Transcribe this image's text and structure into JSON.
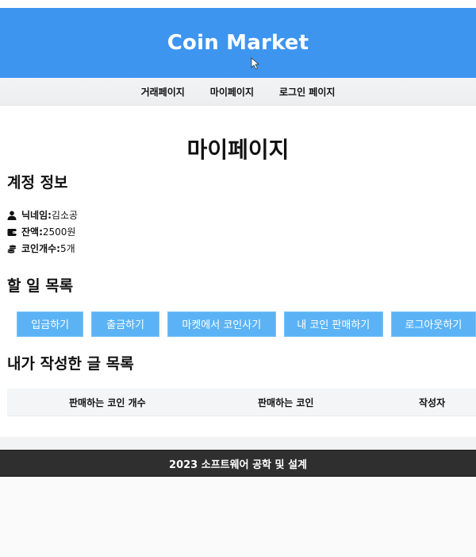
{
  "header": {
    "title": "Coin Market",
    "bg_color": "#3d95f0"
  },
  "nav": {
    "items": [
      "거래페이지",
      "마이페이지",
      "로그인 페이지"
    ]
  },
  "page": {
    "title": "마이페이지"
  },
  "account": {
    "title": "계정 정보",
    "nickname_label": "닉네임:",
    "nickname": "김소공",
    "balance_label": "잔액:",
    "balance": "2500원",
    "coins_label": "코인개수:",
    "coins": "5개"
  },
  "todo": {
    "title": "할 일 목록",
    "buttons": [
      "입금하기",
      "출금하기",
      "마켓에서 코인사기",
      "내 코인 판매하기",
      "로그아웃하기"
    ],
    "button_color": "#5bb3f5"
  },
  "posts": {
    "title": "내가 작성한 글 목록",
    "columns": [
      "판매하는 코인 개수",
      "판매하는 코인",
      "작성자"
    ]
  },
  "footer": {
    "text": "2023 소프트웨어 공학 및 설계"
  },
  "icons": {
    "nickname": "user-icon",
    "balance": "wallet-icon",
    "coins": "coins-icon"
  }
}
